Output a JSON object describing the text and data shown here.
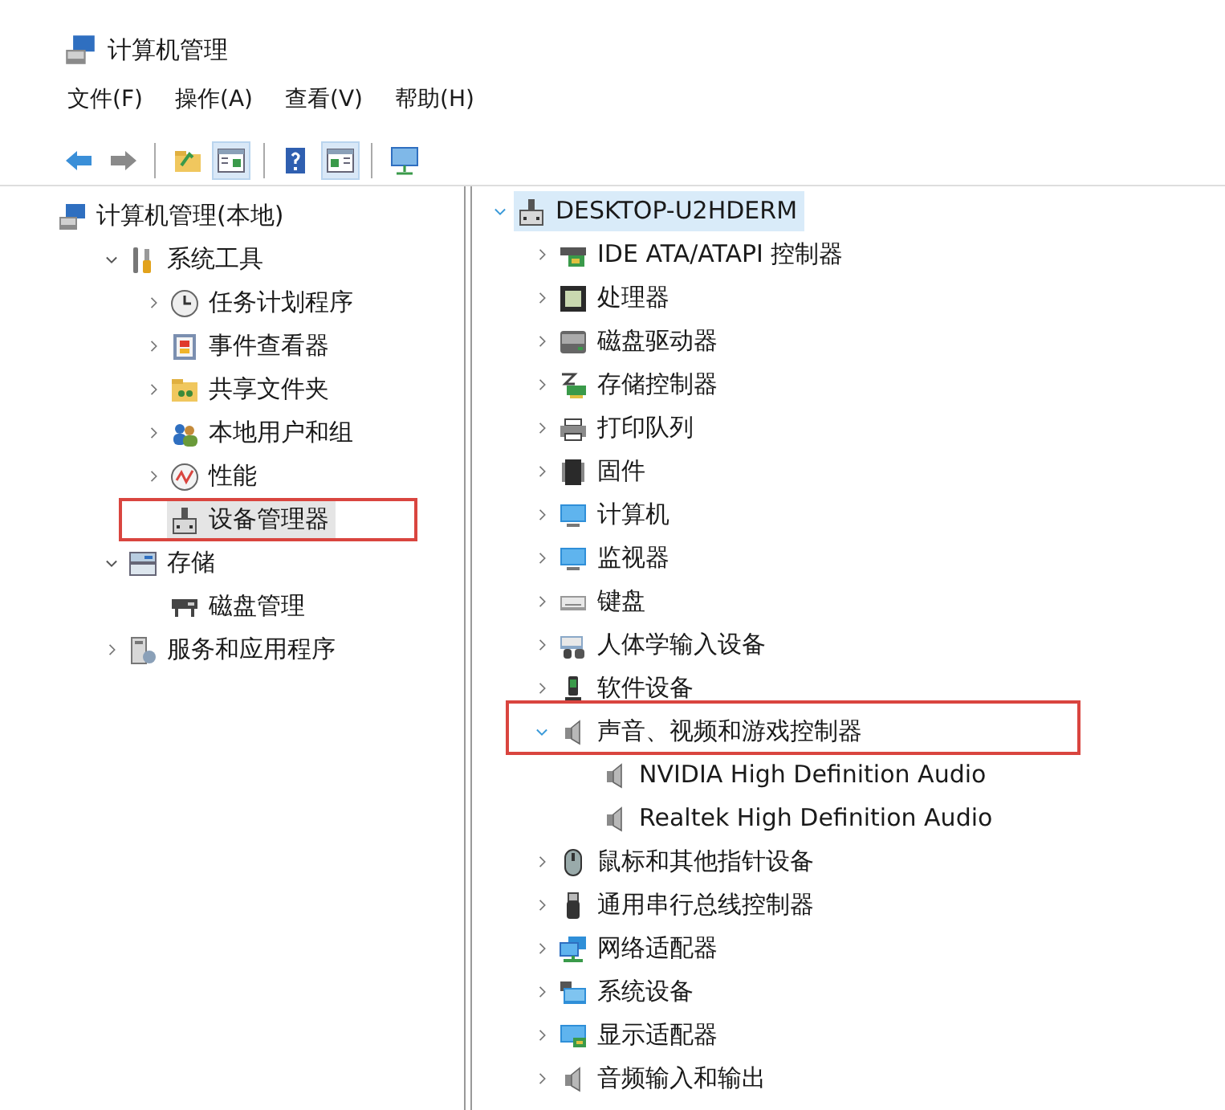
{
  "window": {
    "title": "计算机管理"
  },
  "menu": [
    "文件(F)",
    "操作(A)",
    "查看(V)",
    "帮助(H)"
  ],
  "toolbar": [
    {
      "kind": "back",
      "pressed": false
    },
    {
      "kind": "forward",
      "pressed": false
    },
    {
      "kind": "sep"
    },
    {
      "kind": "folder",
      "pressed": false
    },
    {
      "kind": "tree",
      "pressed": true
    },
    {
      "kind": "sep"
    },
    {
      "kind": "help",
      "pressed": false
    },
    {
      "kind": "pane",
      "pressed": true
    },
    {
      "kind": "sep"
    },
    {
      "kind": "console",
      "pressed": false
    }
  ],
  "left_tree": [
    {
      "label": "计算机管理(本地)",
      "kind": "computer",
      "selected": false,
      "children": [
        {
          "label": "系统工具",
          "kind": "tools",
          "expanded": true,
          "selected": false,
          "children": [
            {
              "label": "任务计划程序",
              "kind": "clock",
              "expanded": false,
              "selected": false
            },
            {
              "label": "事件查看器",
              "kind": "eventlog",
              "expanded": false,
              "selected": false
            },
            {
              "label": "共享文件夹",
              "kind": "share",
              "expanded": false,
              "selected": false
            },
            {
              "label": "本地用户和组",
              "kind": "users",
              "expanded": false,
              "selected": false
            },
            {
              "label": "性能",
              "kind": "perf",
              "expanded": false,
              "selected": false
            },
            {
              "label": "设备管理器",
              "kind": "devmgr",
              "selected": true,
              "highlighted": true
            }
          ]
        },
        {
          "label": "存储",
          "kind": "storage",
          "expanded": true,
          "selected": false,
          "children": [
            {
              "label": "磁盘管理",
              "kind": "disk",
              "selected": false
            }
          ]
        },
        {
          "label": "服务和应用程序",
          "kind": "services",
          "expanded": false,
          "selected": false
        }
      ]
    }
  ],
  "device_tree": [
    {
      "label": "DESKTOP-U2HDERM",
      "kind": "devmgr",
      "expanded": true,
      "selected": true,
      "children": [
        {
          "label": "IDE ATA/ATAPI 控制器",
          "kind": "ide",
          "expanded": false,
          "selected": false
        },
        {
          "label": "处理器",
          "kind": "cpu",
          "expanded": false,
          "selected": false
        },
        {
          "label": "磁盘驱动器",
          "kind": "drive",
          "expanded": false,
          "selected": false
        },
        {
          "label": "存储控制器",
          "kind": "storagectl",
          "expanded": false,
          "selected": false
        },
        {
          "label": "打印队列",
          "kind": "printer",
          "expanded": false,
          "selected": false
        },
        {
          "label": "固件",
          "kind": "chip",
          "expanded": false,
          "selected": false
        },
        {
          "label": "计算机",
          "kind": "monitor",
          "expanded": false,
          "selected": false
        },
        {
          "label": "监视器",
          "kind": "monitor",
          "expanded": false,
          "selected": false
        },
        {
          "label": "键盘",
          "kind": "keyboard",
          "expanded": false,
          "selected": false
        },
        {
          "label": "人体学输入设备",
          "kind": "hid",
          "expanded": false,
          "selected": false
        },
        {
          "label": "软件设备",
          "kind": "softdev",
          "expanded": false,
          "selected": false
        },
        {
          "label": "声音、视频和游戏控制器",
          "kind": "speaker",
          "expanded": true,
          "selected": false,
          "highlighted": true,
          "children": [
            {
              "label": "NVIDIA High Definition Audio",
              "kind": "speaker",
              "selected": false
            },
            {
              "label": "Realtek High Definition Audio",
              "kind": "speaker",
              "selected": false
            }
          ]
        },
        {
          "label": "鼠标和其他指针设备",
          "kind": "mouse",
          "expanded": false,
          "selected": false
        },
        {
          "label": "通用串行总线控制器",
          "kind": "usb",
          "expanded": false,
          "selected": false
        },
        {
          "label": "网络适配器",
          "kind": "network",
          "expanded": false,
          "selected": false
        },
        {
          "label": "系统设备",
          "kind": "sysdev",
          "expanded": false,
          "selected": false
        },
        {
          "label": "显示适配器",
          "kind": "display",
          "expanded": false,
          "selected": false
        },
        {
          "label": "音频输入和输出",
          "kind": "speaker",
          "expanded": false,
          "selected": false
        }
      ]
    }
  ]
}
